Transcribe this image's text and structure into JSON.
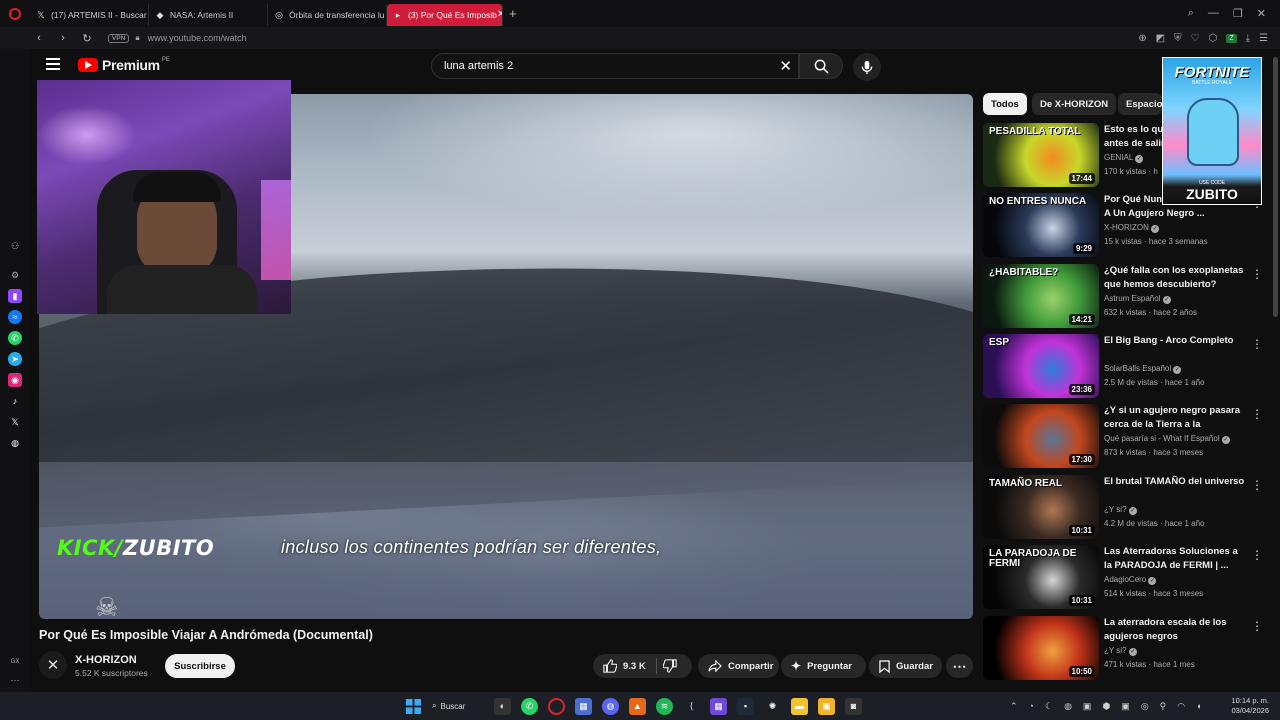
{
  "browser": {
    "tabs": [
      {
        "label": "(17) ARTEMIS II - Buscar /",
        "icon": "x-logo-icon"
      },
      {
        "label": "NASA: Artemis II",
        "icon": "nasa-icon"
      },
      {
        "label": "Órbita de transferencia lu",
        "icon": "globe-icon"
      },
      {
        "label": "(3) Por Qué Es Imposib",
        "icon": "youtube-icon",
        "active": true
      }
    ],
    "url": "www.youtube.com/watch",
    "vpn_label": "VPN",
    "profile_badge": "Z"
  },
  "youtube": {
    "logo_text": "Premium",
    "country": "PE",
    "search_value": "luna artemis 2"
  },
  "video": {
    "subtitle": "incluso los continentes podrían ser diferentes,",
    "overlay_kick": "KICK/",
    "overlay_zubito": "ZUBITO",
    "title": "Por Qué Es Imposible Viajar A Andrómeda (Documental)",
    "channel": "X-HORIZON",
    "subscribers": "5.52 K suscriptores",
    "subscribe_label": "Suscribirse",
    "likes": "9.3 K",
    "share_label": "Compartir",
    "ask_label": "Preguntar",
    "save_label": "Guardar"
  },
  "chips": [
    "Todos",
    "De X-HORIZON",
    "Espacio"
  ],
  "ad": {
    "title": "FORTNITE",
    "subtitle": "BATTLE ROYALE",
    "code_label": "USE CODE",
    "code": "ZUBITO"
  },
  "recommendations": [
    {
      "thumb_text": "PESADILLA TOTAL",
      "duration": "17:44",
      "title": "Esto es lo que debes saber antes de salir",
      "channel": "GENIAL",
      "meta": "170 k vistas · h",
      "colors": [
        "#1b2a14",
        "#c7d82b",
        "#f28a1f"
      ]
    },
    {
      "thumb_text": "NO ENTRES NUNCA",
      "duration": "9:29",
      "title": "Por Qué Nunca Deberías Entrar A Un Agujero Negro ...",
      "channel": "X-HORIZON",
      "meta": "15 k vistas · hace 3 semanas",
      "colors": [
        "#05070d",
        "#2b3b5a",
        "#c9d3e6"
      ]
    },
    {
      "thumb_text": "¿HABITABLE?",
      "duration": "14:21",
      "title": "¿Qué falla con los exoplanetas que hemos descubierto?",
      "channel": "Astrum Español",
      "meta": "632 k vistas · hace 2 años",
      "colors": [
        "#0b1a10",
        "#3f9a3a",
        "#9ad16a"
      ]
    },
    {
      "thumb_text": "ESP",
      "duration": "23:36",
      "title": "El Big Bang - Arco Completo",
      "channel": "SolarBalls Español",
      "meta": "2.5 M de vistas · hace 1 año",
      "colors": [
        "#2a0f55",
        "#c233d8",
        "#2c7fd9"
      ]
    },
    {
      "thumb_text": "",
      "duration": "17:30",
      "title": "¿Y si un agujero negro pasara cerca de la Tierra a la velocida...",
      "channel": "Qué pasaría si - What If Español",
      "meta": "873 k vistas · hace 3 meses",
      "colors": [
        "#0c0a0a",
        "#c2471e",
        "#5d7396"
      ]
    },
    {
      "thumb_text": "TAMAÑO REAL",
      "duration": "10:31",
      "title": "El brutal TAMAÑO del universo",
      "channel": "¿Y si?",
      "meta": "4.2 M de vistas · hace 1 año",
      "colors": [
        "#0a0a0a",
        "#3b2b22",
        "#b07854"
      ]
    },
    {
      "thumb_text": "LA PARADOJA DE FERMI",
      "duration": "10:31",
      "title": "Las Aterradoras Soluciones a la PARADOJA de FERMI | ...",
      "channel": "AdagioCero",
      "meta": "514 k vistas · hace 3 meses",
      "colors": [
        "#050505",
        "#2a2a2a",
        "#d6d6d6"
      ]
    },
    {
      "thumb_text": "",
      "duration": "10:50",
      "title": "La aterradora escala de los agujeros negros",
      "channel": "¿Y si?",
      "meta": "471 k vistas · hace 1 mes",
      "colors": [
        "#000000",
        "#c2331a",
        "#f0a040"
      ]
    }
  ],
  "taskbar": {
    "search_label": "Buscar",
    "time": "10:14 p. m.",
    "date": "03/04/2026"
  },
  "sidebar_label": "GX"
}
